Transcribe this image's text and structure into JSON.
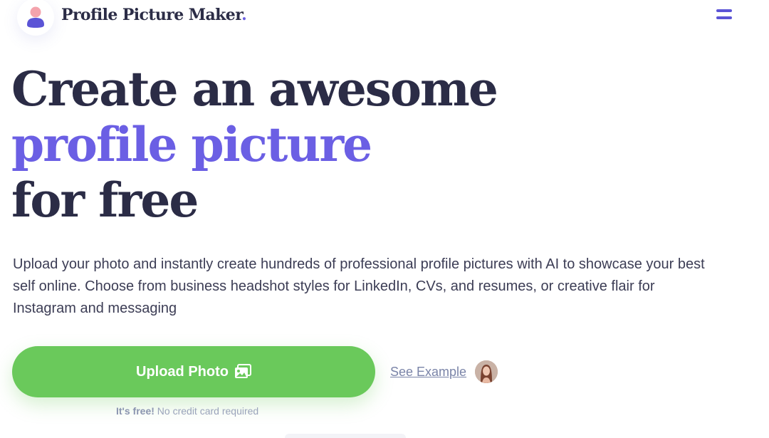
{
  "header": {
    "brand": "Profile Picture Maker",
    "brand_dot": ".",
    "logo_icon": "user-avatar-icon",
    "menu_icon": "hamburger-menu-icon"
  },
  "hero": {
    "headline_line1": "Create an awesome",
    "headline_line2": "profile picture",
    "headline_line3": "for free",
    "description": "Upload your photo and instantly create hundreds of professional profile pictures with AI to showcase your best self online. Choose from business headshot styles for LinkedIn, CVs, and resumes, or creative flair for Instagram and messaging"
  },
  "cta": {
    "upload_label": "Upload Photo",
    "upload_icon": "image-icon",
    "see_example_label": "See Example",
    "note_bold": "It's free!",
    "note_rest": "No credit card required"
  },
  "colors": {
    "accent": "#6b5fe4",
    "text_dark": "#2b2c46",
    "button_green": "#6ac95b",
    "muted": "#9aa3bb"
  }
}
